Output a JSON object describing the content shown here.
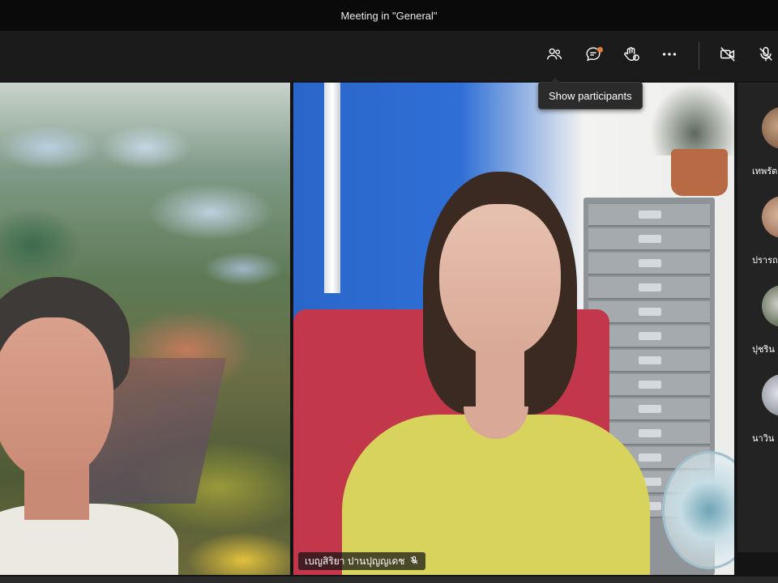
{
  "window": {
    "title": "Meeting in \"General\""
  },
  "toolbar": {
    "buttons": [
      {
        "name": "participants-button",
        "icon": "people-icon"
      },
      {
        "name": "chat-button",
        "icon": "chat-icon",
        "notification": true
      },
      {
        "name": "raise-hand-button",
        "icon": "raise-hand-icon"
      },
      {
        "name": "more-actions-button",
        "icon": "more-icon"
      },
      {
        "name": "camera-toggle-button",
        "icon": "camera-off-icon"
      },
      {
        "name": "mic-toggle-button",
        "icon": "mic-off-icon"
      }
    ]
  },
  "tooltip": {
    "text": "Show participants"
  },
  "videos": [
    {
      "name_label": ""
    },
    {
      "name_label": "เบญสิริยา ปานปุญญเดช",
      "muted": true
    }
  ],
  "sidebar": {
    "participants": [
      {
        "name": "เทพรัต"
      },
      {
        "name": "ปรารถ"
      },
      {
        "name": "ปุชริน"
      },
      {
        "name": "นาวิน"
      }
    ]
  },
  "colors": {
    "accent_notify": "#e37d3b",
    "background": "#1f1f1f",
    "titlebar": "#0a0a0a"
  }
}
